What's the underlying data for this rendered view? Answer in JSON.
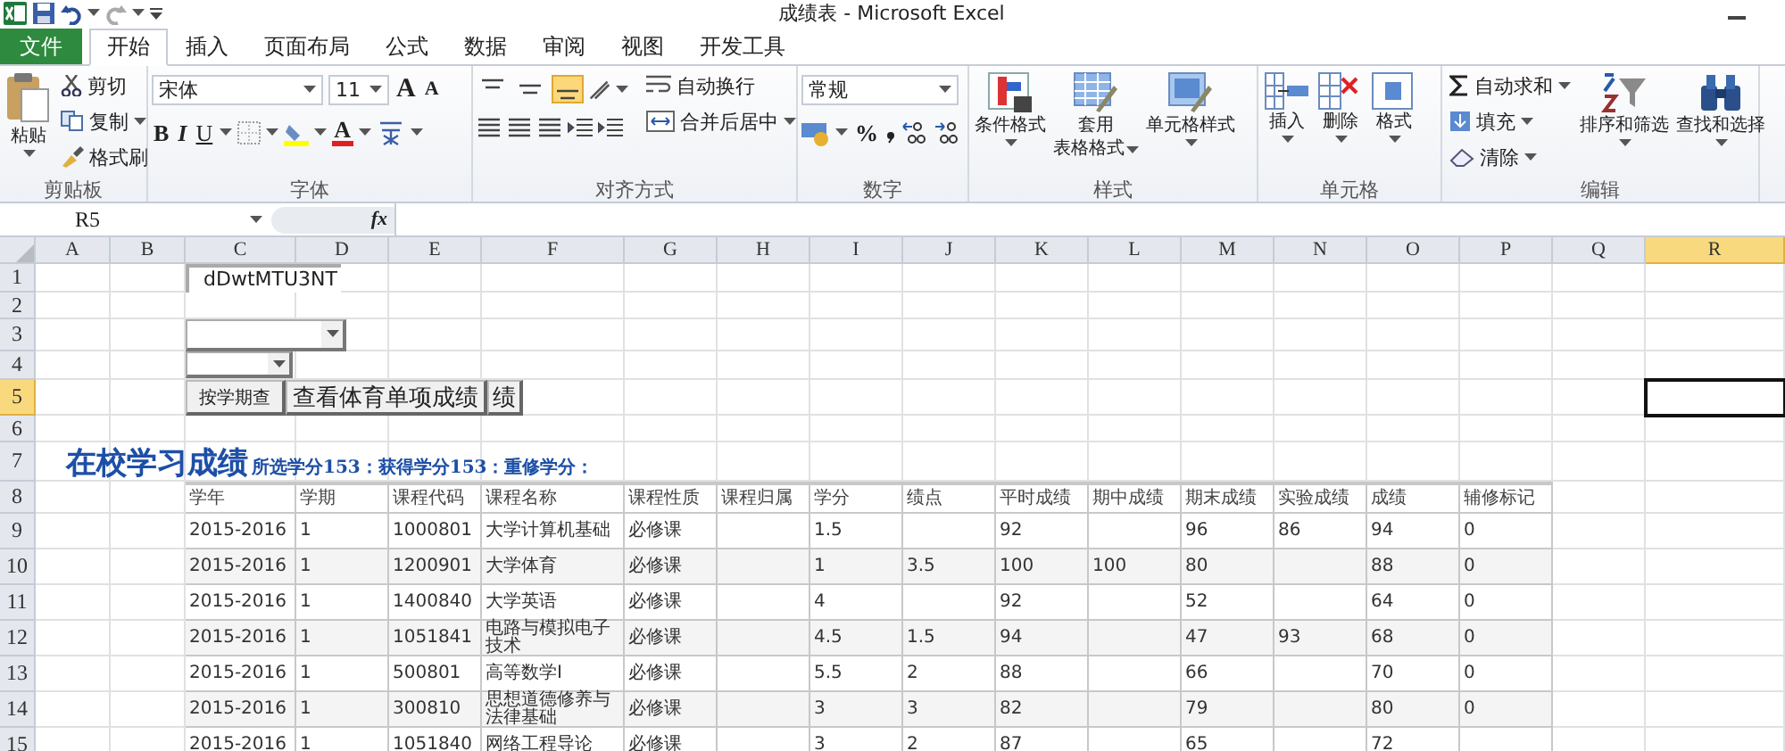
{
  "window": {
    "title": "成绩表 - Microsoft Excel"
  },
  "tabs": [
    {
      "label": "文件",
      "kind": "file",
      "selected": false
    },
    {
      "label": "开始",
      "kind": "tab",
      "selected": true
    },
    {
      "label": "插入",
      "kind": "tab",
      "selected": false
    },
    {
      "label": "页面布局",
      "kind": "tab",
      "selected": false
    },
    {
      "label": "公式",
      "kind": "tab",
      "selected": false
    },
    {
      "label": "数据",
      "kind": "tab",
      "selected": false
    },
    {
      "label": "审阅",
      "kind": "tab",
      "selected": false
    },
    {
      "label": "视图",
      "kind": "tab",
      "selected": false
    },
    {
      "label": "开发工具",
      "kind": "tab",
      "selected": false
    }
  ],
  "ribbon": {
    "clipboard": {
      "label": "剪贴板",
      "paste": "粘贴",
      "cut": "剪切",
      "copy": "复制",
      "format_painter": "格式刷"
    },
    "font": {
      "label": "字体",
      "font_name": "宋体",
      "font_size": "11",
      "grow": "A",
      "shrink": "A",
      "bold": "B",
      "italic": "I",
      "underline": "U",
      "font_color": "A"
    },
    "alignment": {
      "label": "对齐方式",
      "vertical": [
        {
          "selected": false
        },
        {
          "selected": false
        },
        {
          "selected": true
        }
      ],
      "wrap_text": "自动换行",
      "merge_center": "合并后居中"
    },
    "number": {
      "label": "数字",
      "format": "常规",
      "percent": "%"
    },
    "styles": {
      "label": "样式",
      "conditional": "条件格式",
      "table_format": [
        "套用",
        "表格格式"
      ],
      "cell_styles": "单元格样式"
    },
    "cells": {
      "label": "单元格",
      "insert": "插入",
      "delete": "删除",
      "format": "格式"
    },
    "editing": {
      "label": "编辑",
      "autosum": "自动求和",
      "fill": "填充",
      "clear": "清除",
      "sort_filter": "排序和筛选",
      "find_select": "查找和选择"
    }
  },
  "formula_bar": {
    "name_box": "R5",
    "fx": "fx"
  },
  "sheet": {
    "columns": [
      {
        "label": "A",
        "selected": false
      },
      {
        "label": "B",
        "selected": false
      },
      {
        "label": "C",
        "selected": false
      },
      {
        "label": "D",
        "selected": false
      },
      {
        "label": "E",
        "selected": false
      },
      {
        "label": "F",
        "selected": false
      },
      {
        "label": "G",
        "selected": false
      },
      {
        "label": "H",
        "selected": false
      },
      {
        "label": "I",
        "selected": false
      },
      {
        "label": "J",
        "selected": false
      },
      {
        "label": "K",
        "selected": false
      },
      {
        "label": "L",
        "selected": false
      },
      {
        "label": "M",
        "selected": false
      },
      {
        "label": "N",
        "selected": false
      },
      {
        "label": "O",
        "selected": false
      },
      {
        "label": "P",
        "selected": false
      },
      {
        "label": "Q",
        "selected": false
      },
      {
        "label": "R",
        "selected": true
      }
    ],
    "rows": [
      {
        "label": "1",
        "selected": false
      },
      {
        "label": "2",
        "selected": false
      },
      {
        "label": "3",
        "selected": false
      },
      {
        "label": "4",
        "selected": false
      },
      {
        "label": "5",
        "selected": true
      },
      {
        "label": "6",
        "selected": false
      },
      {
        "label": "7",
        "selected": false
      },
      {
        "label": "8",
        "selected": false
      },
      {
        "label": "9",
        "selected": false
      },
      {
        "label": "10",
        "selected": false
      },
      {
        "label": "11",
        "selected": false
      },
      {
        "label": "12",
        "selected": false
      },
      {
        "label": "13",
        "selected": false
      },
      {
        "label": "14",
        "selected": false
      },
      {
        "label": "15",
        "selected": false
      }
    ],
    "textbox": "dDwtMTU3NT",
    "buttons": [
      {
        "label": "按学期查"
      },
      {
        "label": "查看体育单项成绩"
      },
      {
        "label": "绩"
      }
    ],
    "title": "在校学习成绩",
    "summary": "所选学分153：获得学分153：重修学分：",
    "table": {
      "columns": [
        "学年",
        "学期",
        "课程代码",
        "课程名称",
        "课程性质",
        "课程归属",
        "学分",
        "绩点",
        "平时成绩",
        "期中成绩",
        "期末成绩",
        "实验成绩",
        "成绩",
        "辅修标记"
      ],
      "rows": [
        [
          "2015-2016",
          "1",
          "1000801",
          "大学计算机基础",
          "必修课",
          "",
          "1.5",
          "",
          "92",
          "",
          "96",
          "86",
          "94",
          "0"
        ],
        [
          "2015-2016",
          "1",
          "1200901",
          "大学体育",
          "必修课",
          "",
          "1",
          "3.5",
          "100",
          "100",
          "80",
          "",
          "88",
          "0"
        ],
        [
          "2015-2016",
          "1",
          "1400840",
          "大学英语",
          "必修课",
          "",
          "4",
          "",
          "92",
          "",
          "52",
          "",
          "64",
          "0"
        ],
        [
          "2015-2016",
          "1",
          "1051841",
          "电路与模拟电子技术",
          "必修课",
          "",
          "4.5",
          "1.5",
          "94",
          "",
          "47",
          "93",
          "68",
          "0"
        ],
        [
          "2015-2016",
          "1",
          "500801",
          "高等数学Ⅰ",
          "必修课",
          "",
          "5.5",
          "2",
          "88",
          "",
          "66",
          "",
          "70",
          "0"
        ],
        [
          "2015-2016",
          "1",
          "300810",
          "思想道德修养与法律基础",
          "必修课",
          "",
          "3",
          "3",
          "82",
          "",
          "79",
          "",
          "80",
          "0"
        ],
        [
          "2015-2016",
          "1",
          "1051840",
          "网络工程导论",
          "必修课",
          "",
          "3",
          "2",
          "87",
          "",
          "65",
          "",
          "72",
          ""
        ]
      ]
    }
  }
}
